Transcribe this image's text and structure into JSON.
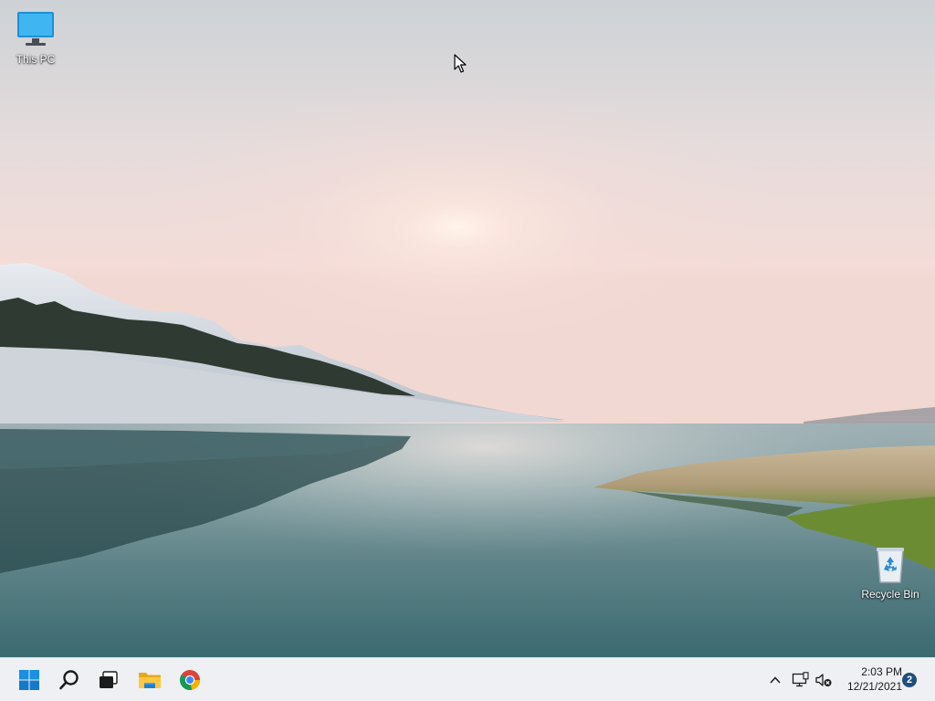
{
  "desktop": {
    "icons": [
      {
        "label": "This PC",
        "icon": "monitor-icon"
      },
      {
        "label": "Recycle Bin",
        "icon": "recycle-bin-icon"
      }
    ]
  },
  "taskbar": {
    "pinned": [
      {
        "name": "Start",
        "icon": "windows-logo-icon"
      },
      {
        "name": "Search",
        "icon": "search-icon"
      },
      {
        "name": "Task View",
        "icon": "task-view-icon"
      },
      {
        "name": "File Explorer",
        "icon": "folder-icon"
      },
      {
        "name": "Google Chrome",
        "icon": "chrome-icon"
      }
    ],
    "tray": {
      "icons": [
        "chevron-up-icon",
        "network-icon",
        "volume-muted-icon"
      ],
      "time": "2:03 PM",
      "date": "12/21/2021",
      "notification_count": "2"
    },
    "colors": {
      "background": "#eef0f3",
      "accent": "#0078d4",
      "badge": "#1f4e79"
    }
  }
}
